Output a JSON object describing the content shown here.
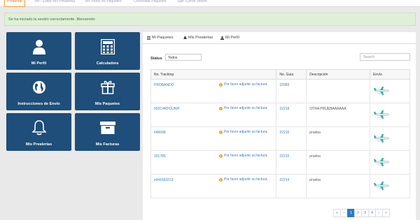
{
  "topnav": [
    {
      "label": "Prealertar",
      "active": true
    },
    {
      "label": "Ver / Editar Mis Prealertas",
      "active": false
    },
    {
      "label": "Ver Todos los Paquetes",
      "active": false
    },
    {
      "label": "Consolidar Paquetes",
      "active": false
    },
    {
      "label": "Salir /Cerrar sesión",
      "active": false
    }
  ],
  "alert": "Se ha iniciado la sesión correctamente. Bienvendo",
  "tiles": [
    {
      "label": "Mi Perfil",
      "icon": "user-icon"
    },
    {
      "label": "Calculadora",
      "icon": "calculator-icon"
    },
    {
      "label": "Instrucciones de Envío",
      "icon": "globe-icon"
    },
    {
      "label": "Mis Paquetes",
      "icon": "gift-icon"
    },
    {
      "label": "Mis Prealertas",
      "icon": "bell-icon"
    },
    {
      "label": "Mis Facturas",
      "icon": "archive-icon"
    }
  ],
  "tabs": [
    {
      "label": "Mi Paquetes",
      "icon": "list-icon"
    },
    {
      "label": "Mis Prealertas",
      "icon": "bell-icon"
    },
    {
      "label": "Mi Perfil",
      "icon": "user-icon"
    }
  ],
  "filter": {
    "status_label": "Status",
    "status_value": "Todos",
    "search_placeholder": "Search"
  },
  "table": {
    "headers": [
      "No. Tracking",
      "No. Guia",
      "Descripción",
      "Envío"
    ],
    "attach_text": "Por favor adjunte su factura.",
    "rows": [
      {
        "tracking": "PROBANDO",
        "guia": "22083",
        "desc": ""
      },
      {
        "tracking": "552C4RFOUNH",
        "guia": "22218",
        "desc": "OTRA PRUEBAAAAAA"
      },
      {
        "tracking": "649548",
        "guia": "22216",
        "desc": "prueba"
      },
      {
        "tracking": "201785",
        "guia": "22215",
        "desc": "prueba"
      },
      {
        "tracking": "s941663213",
        "guia": "22214",
        "desc": "prueba"
      }
    ]
  },
  "pagination": [
    "«",
    "‹",
    "1",
    "2",
    "3",
    "4",
    "›",
    "»"
  ],
  "pagination_active": "1",
  "colors": {
    "tile": "#1e4e79",
    "accent": "#f39c33",
    "link": "#3a7bbf",
    "alert_bg": "#dff0d8"
  }
}
